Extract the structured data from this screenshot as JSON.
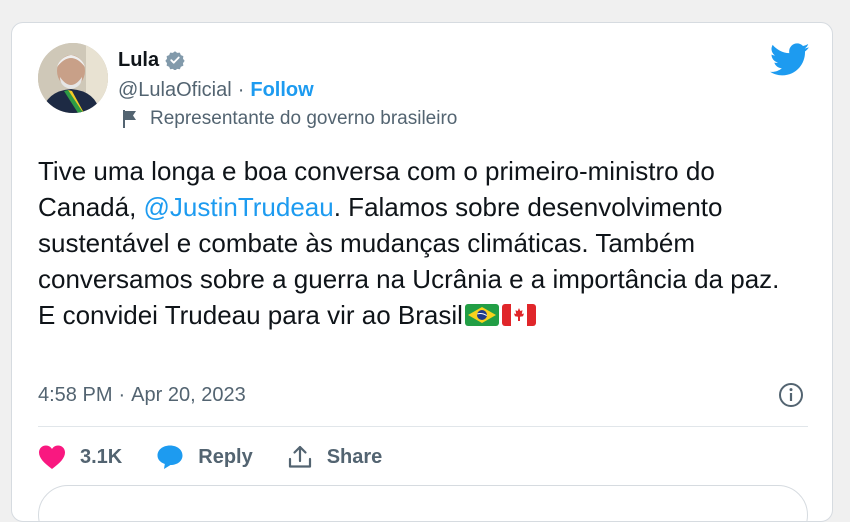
{
  "author": {
    "name": "Lula",
    "handle": "@LulaOficial",
    "separator": "·",
    "follow_label": "Follow",
    "label": "Representante do governo brasileiro"
  },
  "tweet": {
    "text_before": "Tive uma longa e boa conversa com o primeiro-ministro do Canadá, ",
    "mention": "@JustinTrudeau",
    "text_after": ". Falamos sobre desenvolvimento sustentável e combate às mudanças climáticas. Também conversamos sobre a guerra na Ucrânia e a importância da paz. E convidei Trudeau para vir ao Brasil",
    "emojis": [
      "brazil-flag",
      "canada-flag"
    ]
  },
  "meta": {
    "time": "4:58 PM",
    "separator": "·",
    "date": "Apr 20, 2023"
  },
  "actions": {
    "likes": "3.1K",
    "reply_label": "Reply",
    "share_label": "Share"
  },
  "colors": {
    "accent": "#1d9bf0",
    "like": "#f91880",
    "text": "#0f1419",
    "secondary": "#536471"
  },
  "icons": [
    "avatar",
    "verified-badge-icon",
    "twitter-bird-icon",
    "flag-icon",
    "info-icon",
    "heart-icon",
    "reply-bubble-icon",
    "share-icon"
  ]
}
